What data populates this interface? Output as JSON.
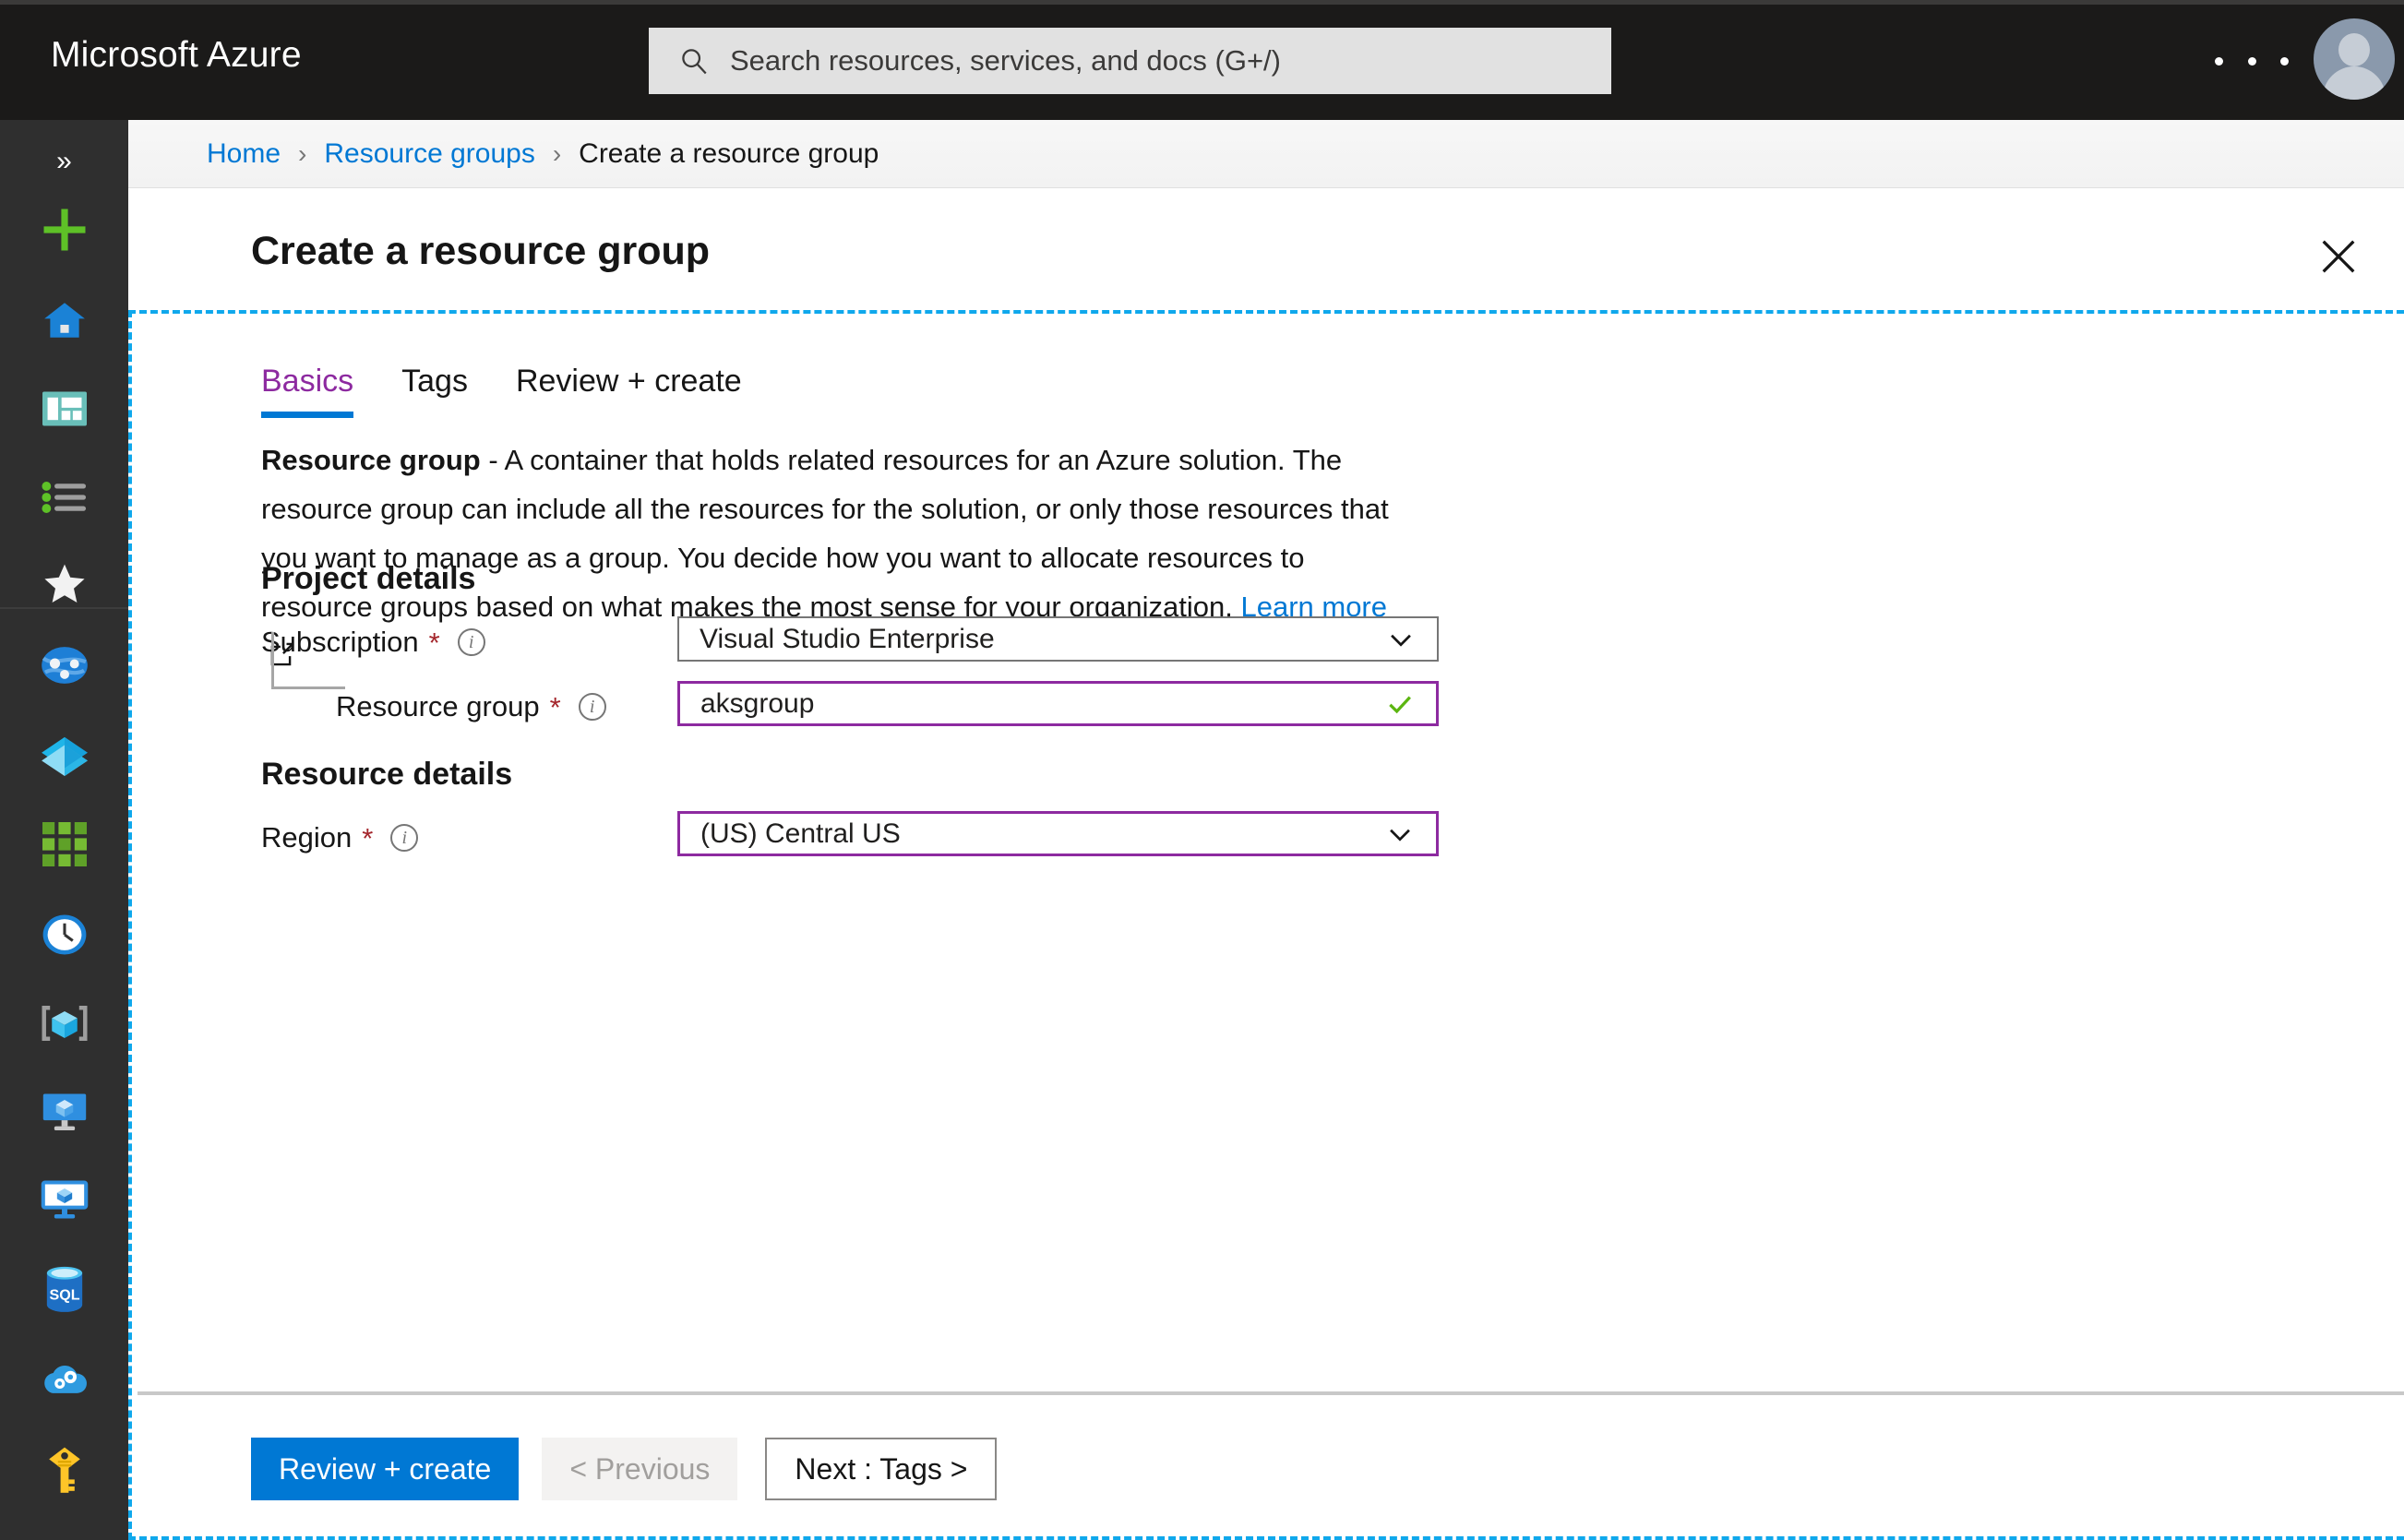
{
  "topbar": {
    "brand": "Microsoft Azure",
    "search": {
      "placeholder": "Search resources, services, and docs (G+/)",
      "value": "",
      "icon": "search-icon"
    },
    "more_label": "…",
    "avatar_label": "Account"
  },
  "rail": {
    "collapse_label": "»",
    "items": [
      {
        "name": "create-a-resource",
        "icon": "plus-icon"
      },
      {
        "name": "home",
        "icon": "home-icon"
      },
      {
        "name": "dashboard",
        "icon": "dashboard-icon"
      },
      {
        "name": "all-services",
        "icon": "list-icon"
      },
      {
        "name": "favorites",
        "icon": "star-icon"
      },
      {
        "name": "azure-active-directory",
        "icon": "aad-icon"
      },
      {
        "name": "resource-groups",
        "icon": "resource-groups-icon"
      },
      {
        "name": "all-resources",
        "icon": "grid-icon"
      },
      {
        "name": "recent",
        "icon": "clock-icon"
      },
      {
        "name": "app-services",
        "icon": "app-services-icon"
      },
      {
        "name": "virtual-machines",
        "icon": "virtual-machines-icon"
      },
      {
        "name": "virtual-machines-classic",
        "icon": "vm-classic-icon"
      },
      {
        "name": "sql-databases",
        "icon": "sql-icon"
      },
      {
        "name": "cloud-services",
        "icon": "cloud-services-icon"
      },
      {
        "name": "key-vaults",
        "icon": "key-icon"
      }
    ]
  },
  "breadcrumb": {
    "items": [
      {
        "label": "Home",
        "current": false
      },
      {
        "label": "Resource groups",
        "current": false
      },
      {
        "label": "Create a resource group",
        "current": true
      }
    ],
    "separator": "›"
  },
  "blade": {
    "title": "Create a resource group",
    "close_label": "✕"
  },
  "tabs": [
    {
      "label": "Basics",
      "active": true
    },
    {
      "label": "Tags",
      "active": false
    },
    {
      "label": "Review + create",
      "active": false
    }
  ],
  "description": {
    "lead": "Resource group",
    "body": " - A container that holds related resources for an Azure solution. The resource group can include all the resources for the solution, or only those resources that you want to manage as a group. You decide how you want to allocate resources to resource groups based on what makes the most sense for your organization. ",
    "link": "Learn more",
    "link_icon": "external-link-icon"
  },
  "form": {
    "project_details_title": "Project details",
    "resource_details_title": "Resource details",
    "fields": {
      "subscription": {
        "label": "Subscription",
        "required_marker": "*",
        "info": "i",
        "value": "Visual Studio Enterprise",
        "affix_icon": "chevron-down-icon",
        "options": [
          "Visual Studio Enterprise"
        ]
      },
      "resource_group": {
        "label": "Resource group",
        "required_marker": "*",
        "info": "i",
        "value": "aksgroup",
        "placeholder": "",
        "affix_icon": "checkmark-icon"
      },
      "region": {
        "label": "Region",
        "required_marker": "*",
        "info": "i",
        "value": "(US) Central US",
        "affix_icon": "chevron-down-icon",
        "options": [
          "(US) Central US"
        ]
      }
    }
  },
  "footer": {
    "review_create": "Review + create",
    "previous": "< Previous",
    "next": "Next : Tags >"
  },
  "colors": {
    "accent_blue": "#0078d4",
    "tab_active": "#8d2aa0",
    "required_red": "#a4262c",
    "valid_green": "#5cb611",
    "focus_dashed": "#0fa8ec",
    "topbar_bg": "#1b1a19",
    "rail_bg": "#2f2f2f"
  }
}
